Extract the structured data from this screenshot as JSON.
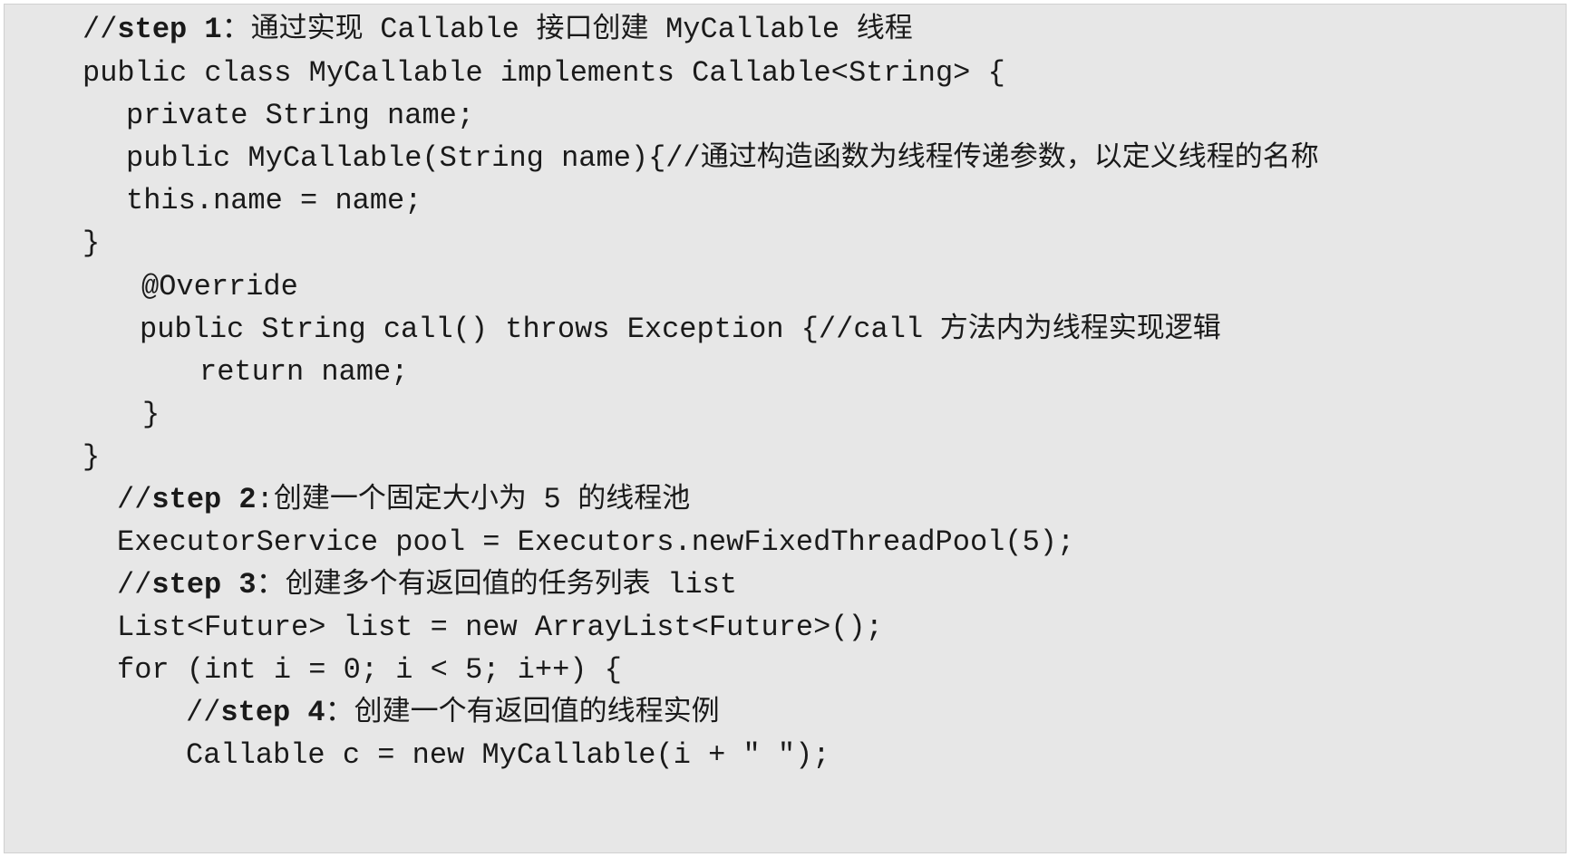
{
  "lines": [
    {
      "parts": [
        {
          "t": "//"
        },
        {
          "t": "step 1",
          "b": true
        },
        {
          "t": "："
        },
        {
          "t": "通过实现 ",
          "c": true
        },
        {
          "t": "Callable"
        },
        {
          "t": " 接口创建 ",
          "c": true
        },
        {
          "t": "MyCallable"
        },
        {
          "t": " 线程",
          "c": true
        }
      ]
    },
    {
      "parts": [
        {
          "t": "public class MyCallable implements Callable<String> {"
        }
      ]
    },
    {
      "parts": [
        {
          "t": "private String name;"
        }
      ]
    },
    {
      "parts": [
        {
          "t": "public MyCallable(String name){//"
        },
        {
          "t": "通过构造函数为线程传递参数，以定义线程的名称",
          "c": true
        }
      ]
    },
    {
      "parts": [
        {
          "t": "this.name = name;"
        }
      ]
    },
    {
      "parts": [
        {
          "t": "}"
        }
      ]
    },
    {
      "parts": [
        {
          "t": "@Override"
        }
      ]
    },
    {
      "parts": [
        {
          "t": "public String call() throws Exception {//call"
        },
        {
          "t": " 方法内为线程实现逻辑",
          "c": true
        }
      ]
    },
    {
      "parts": [
        {
          "t": "return name;"
        }
      ]
    },
    {
      "parts": [
        {
          "t": "}"
        }
      ]
    },
    {
      "parts": [
        {
          "t": "}"
        }
      ]
    },
    {
      "parts": [
        {
          "t": "//"
        },
        {
          "t": "step 2",
          "b": true
        },
        {
          "t": ":"
        },
        {
          "t": "创建一个固定大小为 ",
          "c": true
        },
        {
          "t": "5"
        },
        {
          "t": " 的线程池",
          "c": true
        }
      ]
    },
    {
      "parts": [
        {
          "t": "ExecutorService pool = Executors.newFixedThreadPool(5);"
        }
      ]
    },
    {
      "parts": [
        {
          "t": "//"
        },
        {
          "t": "step 3",
          "b": true
        },
        {
          "t": "："
        },
        {
          "t": "创建多个有返回值的任务列表 ",
          "c": true
        },
        {
          "t": "list"
        }
      ]
    },
    {
      "parts": [
        {
          "t": "List<Future> list = new ArrayList<Future>();"
        }
      ]
    },
    {
      "parts": [
        {
          "t": "for (int i = 0; i < 5; i++) {"
        }
      ]
    },
    {
      "parts": [
        {
          "t": "//"
        },
        {
          "t": "step 4",
          "b": true
        },
        {
          "t": "："
        },
        {
          "t": "创建一个有返回值的线程实例",
          "c": true
        }
      ]
    },
    {
      "parts": [
        {
          "t": "Callable c = new MyCallable(i + \" \");"
        }
      ]
    }
  ]
}
